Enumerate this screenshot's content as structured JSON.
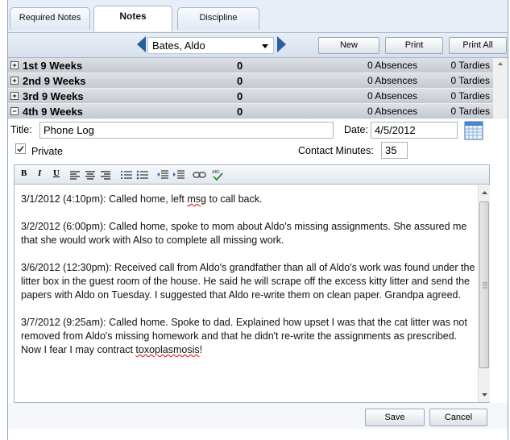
{
  "tabs": [
    {
      "label": "Required Notes"
    },
    {
      "label": "Notes"
    },
    {
      "label": "Discipline"
    }
  ],
  "navbar": {
    "student": "Bates, Aldo",
    "new_label": "New",
    "print_label": "Print",
    "print_all_label": "Print All"
  },
  "quarters": [
    {
      "toggle": "+",
      "name": "1st 9 Weeks",
      "count": "0",
      "absences": "0 Absences",
      "tardies": "0 Tardies"
    },
    {
      "toggle": "+",
      "name": "2nd 9 Weeks",
      "count": "0",
      "absences": "0 Absences",
      "tardies": "0 Tardies"
    },
    {
      "toggle": "+",
      "name": "3rd 9 Weeks",
      "count": "0",
      "absences": "0 Absences",
      "tardies": "0 Tardies"
    },
    {
      "toggle": "−",
      "name": "4th 9 Weeks",
      "count": "0",
      "absences": "0 Absences",
      "tardies": "0 Tardies"
    }
  ],
  "form": {
    "title_label": "Title:",
    "title_value": "Phone Log",
    "date_label": "Date:",
    "date_value": "4/5/2012",
    "private_label": "Private",
    "private_checked": true,
    "contact_label": "Contact Minutes:",
    "contact_value": "35"
  },
  "toolbar": {
    "bold": "B",
    "italic": "I",
    "underline": "U"
  },
  "notes": [
    {
      "before": "3/1/2012 (4:10pm):  Called home, left ",
      "misspelled": "msg",
      "after": " to call back."
    },
    {
      "before": "3/2/2012 (6:00pm):  Called home, spoke to mom about Aldo's missing assignments.  She assured me that she would work with Also to complete all missing work.",
      "misspelled": "",
      "after": ""
    },
    {
      "before": "3/6/2012 (12:30pm):  Received call from Aldo's grandfather than all of Aldo's work was found under the litter box in the guest room of the house.  He said he will scrape off the excess kitty litter and send the papers with Aldo on Tuesday.  I suggested that Aldo re-write them on clean paper.  Grandpa agreed.",
      "misspelled": "",
      "after": ""
    },
    {
      "before": "3/7/2012 (9:25am):  Called home.  Spoke to dad.  Explained how upset I was that the cat litter was not removed from Aldo's missing homework and that he didn't re-write the assignments as prescribed.  Now I fear I may contract ",
      "misspelled": "toxoplasmosis",
      "after": "!"
    }
  ],
  "actions": {
    "save_label": "Save",
    "cancel_label": "Cancel"
  },
  "colors": {
    "accent": "#2a5fa0",
    "header_bg": "#d7e0ec"
  }
}
